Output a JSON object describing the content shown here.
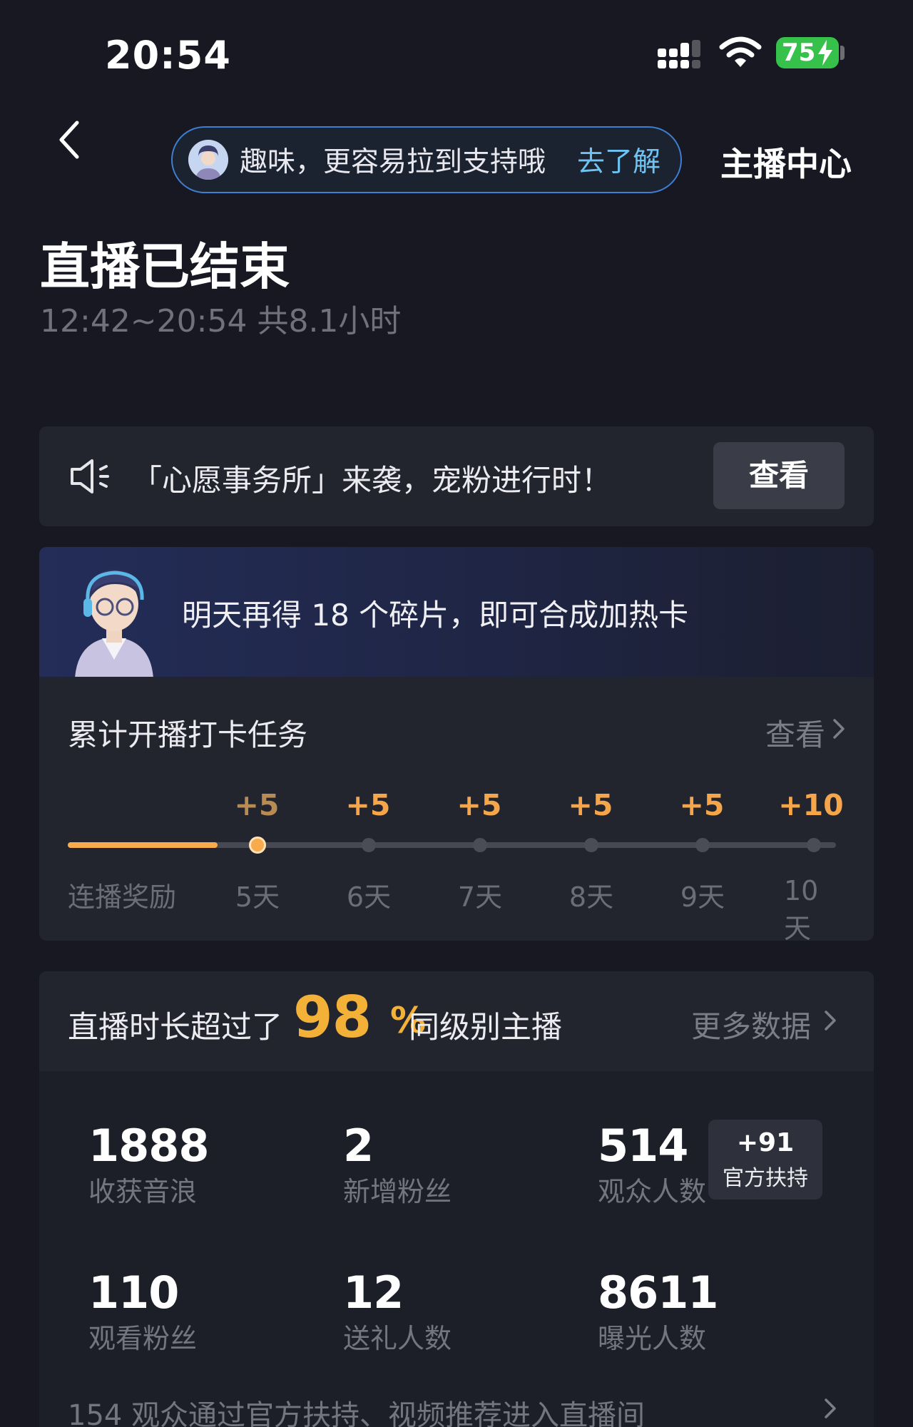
{
  "status_bar": {
    "time": "20:54",
    "battery": "75"
  },
  "nav": {
    "pill_text": "趣味，更容易拉到支持哦",
    "pill_link": "去了解",
    "host_center": "主播中心"
  },
  "header": {
    "title": "直播已结束",
    "subtitle": "12:42~20:54 共8.1小时"
  },
  "notice": {
    "text": "「心愿事务所」来袭，宠粉进行时！",
    "button": "查看"
  },
  "banner": {
    "text": "明天再得 18 个碎片，即可合成加热卡"
  },
  "task": {
    "title": "累计开播打卡任务",
    "view_label": "查看",
    "streak_label": "连播奖励",
    "progress_fraction": 0.195,
    "milestones": [
      {
        "reward": "+5",
        "day": "5天",
        "reached": true
      },
      {
        "reward": "+5",
        "day": "6天",
        "reached": false
      },
      {
        "reward": "+5",
        "day": "7天",
        "reached": false
      },
      {
        "reward": "+5",
        "day": "8天",
        "reached": false
      },
      {
        "reward": "+5",
        "day": "9天",
        "reached": false
      },
      {
        "reward": "+10",
        "day": "10天",
        "reached": false
      }
    ]
  },
  "stats": {
    "headline_pre": "直播时长超过了",
    "headline_percent": "98",
    "headline_percent_sign": "%",
    "headline_post": "同级别主播",
    "more_label": "更多数据",
    "items": [
      {
        "value": "1888",
        "label": "收获音浪"
      },
      {
        "value": "2",
        "label": "新增粉丝"
      },
      {
        "value": "514",
        "label": "观众人数"
      },
      {
        "value": "110",
        "label": "观看粉丝"
      },
      {
        "value": "12",
        "label": "送礼人数"
      },
      {
        "value": "8611",
        "label": "曝光人数"
      }
    ],
    "official_support": {
      "value": "+91",
      "label": "官方扶持"
    },
    "footer": "154 观众通过官方扶持、视频推荐进入直播间"
  },
  "colors": {
    "accent_orange": "#f7ab4c",
    "percent_gold": "#f3b137",
    "link_blue": "#6ec3f2",
    "battery_green": "#36c24a"
  }
}
